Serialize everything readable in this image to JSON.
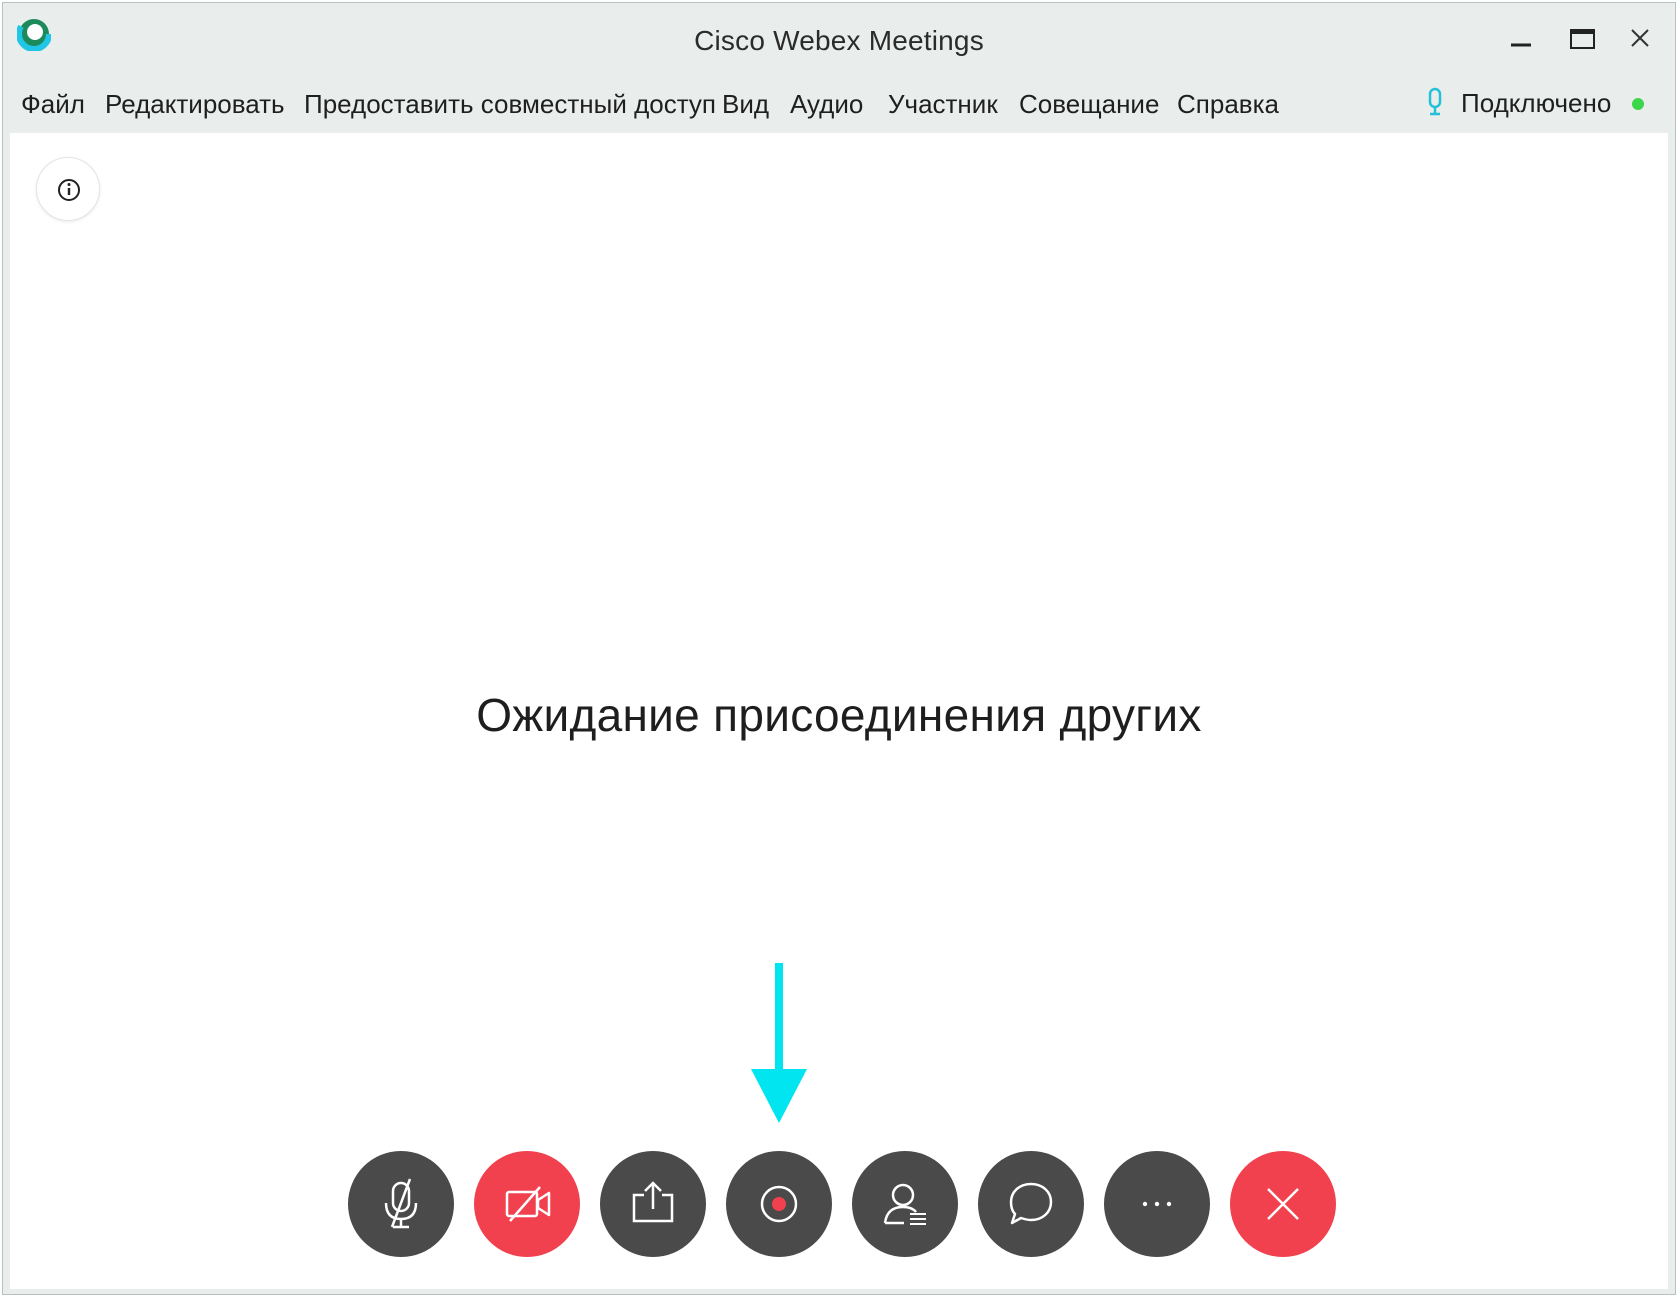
{
  "window": {
    "title": "Cisco Webex Meetings"
  },
  "menu": {
    "items": [
      {
        "label": "Файл"
      },
      {
        "label": "Редактировать"
      },
      {
        "label": "Предоставить совместный доступ"
      },
      {
        "label": "Вид"
      },
      {
        "label": "Аудио"
      },
      {
        "label": "Участник"
      },
      {
        "label": "Совещание"
      },
      {
        "label": "Справка"
      }
    ]
  },
  "status": {
    "text": "Подключено",
    "dot_color": "#3dd64a",
    "mic_color": "#23c1d8"
  },
  "main": {
    "waiting_text": "Ожидание присоединения других"
  },
  "controls": [
    {
      "name": "mute-button",
      "icon": "microphone-muted-icon",
      "bg": "#4a4a4a"
    },
    {
      "name": "video-button",
      "icon": "video-off-icon",
      "bg": "#f1414f"
    },
    {
      "name": "share-button",
      "icon": "share-icon",
      "bg": "#4a4a4a"
    },
    {
      "name": "record-button",
      "icon": "record-icon",
      "bg": "#4a4a4a"
    },
    {
      "name": "participants-button",
      "icon": "participants-icon",
      "bg": "#4a4a4a"
    },
    {
      "name": "chat-button",
      "icon": "chat-icon",
      "bg": "#4a4a4a"
    },
    {
      "name": "more-options-button",
      "icon": "more-icon",
      "bg": "#4a4a4a"
    },
    {
      "name": "leave-meeting-button",
      "icon": "close-icon",
      "bg": "#f1414f"
    }
  ],
  "colors": {
    "accent_arrow": "#00e5f0",
    "record_dot": "#f1414f",
    "button_dark": "#4a4a4a",
    "button_red": "#f1414f"
  }
}
